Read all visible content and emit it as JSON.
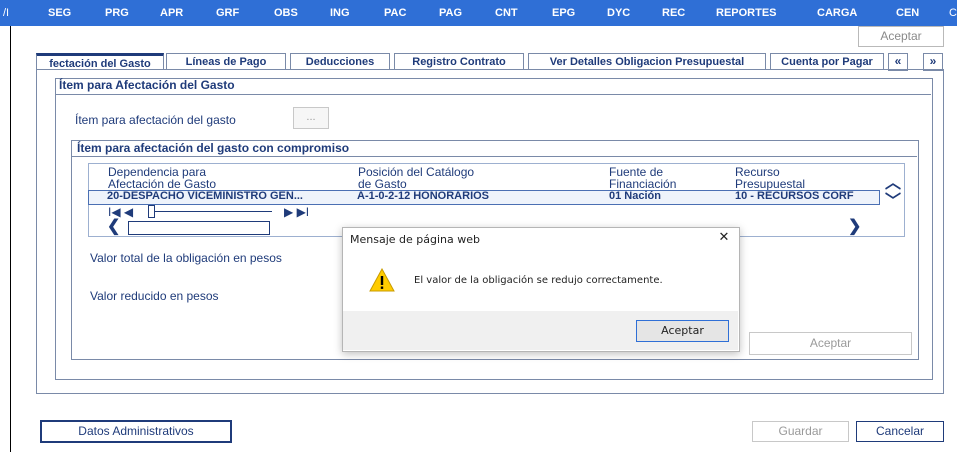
{
  "nav": {
    "left_edge": "/I",
    "items": [
      "SEG",
      "PRG",
      "APR",
      "GRF",
      "OBS",
      "ING",
      "PAC",
      "PAG",
      "CNT",
      "EPG",
      "DYC",
      "REC",
      "REPORTES",
      "CARGA",
      "CEN"
    ],
    "right_edge": "C"
  },
  "top_accept": "Aceptar",
  "tabs": [
    "fectación del Gasto",
    "Líneas de Pago",
    "Deducciones",
    "Registro Contrato",
    "Ver Detalles Obligacion Presupuestal",
    "Cuenta por Pagar"
  ],
  "tab_nav": {
    "prev": "«",
    "next": "»"
  },
  "section": {
    "legend": "Ítem para Afectación del Gasto",
    "item_label": "Ítem para afectación del gasto",
    "item_button": "...",
    "inner_legend": "Ítem para afectación del gasto con compromiso"
  },
  "grid": {
    "columns": [
      {
        "line1": "Dependencia para",
        "line2": "Afectación de Gasto"
      },
      {
        "line1": "Posición del Catálogo",
        "line2": "de Gasto"
      },
      {
        "line1": "Fuente de",
        "line2": "Financiación"
      },
      {
        "line1": "Recurso",
        "line2": "Presupuestal"
      }
    ],
    "row": [
      "20-DESPACHO VICEMINISTRO GEN...",
      "A-1-0-2-12 HONORARIOS",
      "01 Nación",
      "10 - RECURSOS CORF"
    ],
    "pager_left": "I◀ ◀",
    "pager_right": "▶ ▶I"
  },
  "fields": {
    "total_label": "Valor total de la obligación en pesos",
    "reduced_label": "Valor reducido en pesos",
    "accept_button": "Aceptar"
  },
  "bottom": {
    "datos": "Datos Administrativos",
    "guardar": "Guardar",
    "cancelar": "Cancelar"
  },
  "dialog": {
    "title": "Mensaje de página web",
    "close": "✕",
    "message": "El valor de la obligación se redujo correctamente.",
    "ok": "Aceptar",
    "icon": "warning-icon"
  },
  "colors": {
    "nav_bg": "#2f6fd6",
    "text": "#1f3b7a",
    "warning": "#ffcc00"
  }
}
